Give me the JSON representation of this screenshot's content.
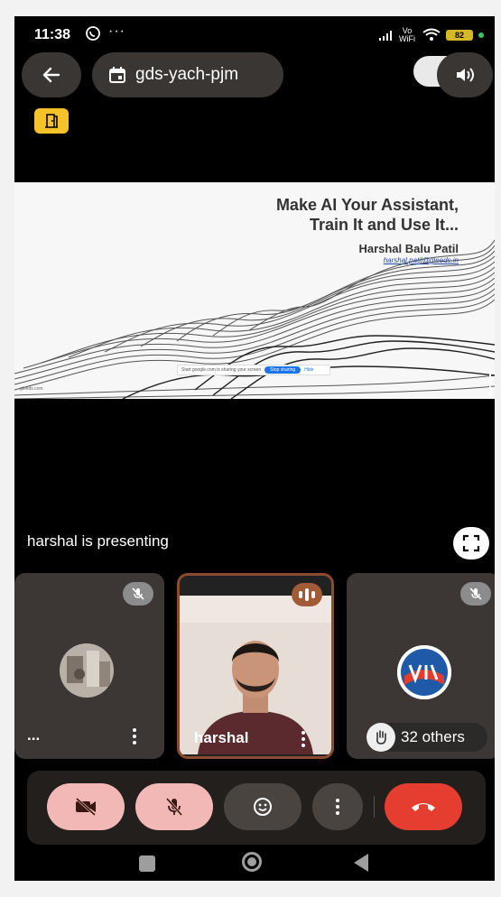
{
  "status_bar": {
    "time": "11:38",
    "more_indicator": "···",
    "network_label": "Vo WiFi",
    "battery_level": "82",
    "icons": [
      "whatsapp-icon",
      "signal-icon",
      "wifi-icon",
      "battery-icon"
    ]
  },
  "top_bar": {
    "meeting_code": "gds-yach-pjm",
    "icons": [
      "back-arrow-icon",
      "calendar-icon",
      "speaker-icon",
      "door-icon"
    ]
  },
  "slide": {
    "title_line1": "Make AI Your Assistant,",
    "title_line2": "Train It and Use It...",
    "presenter_name": "Harshal Balu Patil",
    "presenter_email": "harshal.patil@gleeds.in",
    "share_notice": "Start google.com is sharing your screen",
    "stop_sharing": "Stop sharing",
    "hide": "Hide",
    "watermark": "gleeds.com"
  },
  "presenting_text": "harshal is presenting",
  "tiles": [
    {
      "name": "...",
      "muted": true
    },
    {
      "name": "harshal",
      "speaking": true
    },
    {
      "others_label": "32 others",
      "muted": true
    }
  ],
  "controls": {
    "icons": [
      "camera-off-icon",
      "mic-off-icon",
      "emoji-icon",
      "more-options-icon",
      "hang-up-icon"
    ]
  },
  "colors": {
    "accent_yellow": "#f6c22a",
    "pill_bg": "#3a3633",
    "control_pink": "#f2b8b5",
    "hangup_red": "#e53e31",
    "speaking_orange": "#a35a36"
  }
}
